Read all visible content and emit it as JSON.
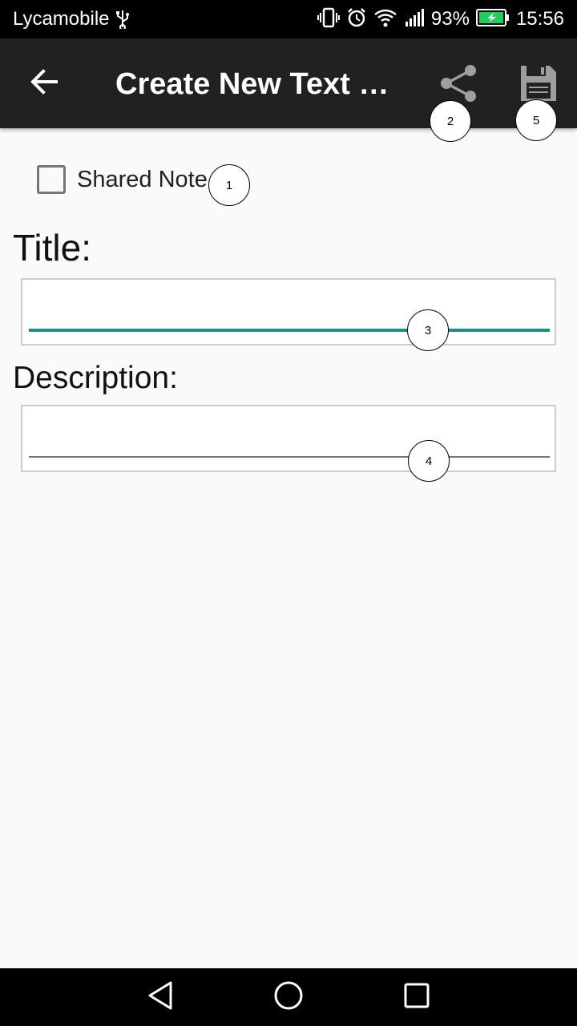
{
  "status_bar": {
    "carrier": "Lycamobile",
    "battery_percent": "93%",
    "time": "15:56"
  },
  "app_bar": {
    "title": "Create New Text N...",
    "back_icon": "arrow-back-icon",
    "share_icon": "share-icon",
    "save_icon": "floppy-disk-icon"
  },
  "form": {
    "shared_note_label": "Shared Note",
    "shared_note_checked": false,
    "title_label": "Title:",
    "title_value": "",
    "description_label": "Description:",
    "description_value": ""
  },
  "markers": [
    "1",
    "2",
    "3",
    "4",
    "5"
  ],
  "nav_bar": {
    "icons": [
      "back-triangle-icon",
      "home-circle-icon",
      "recents-square-icon"
    ]
  },
  "colors": {
    "status_bar": "#000000",
    "app_bar": "#212121",
    "accent": "#1b8f85",
    "background": "#fafafa"
  }
}
